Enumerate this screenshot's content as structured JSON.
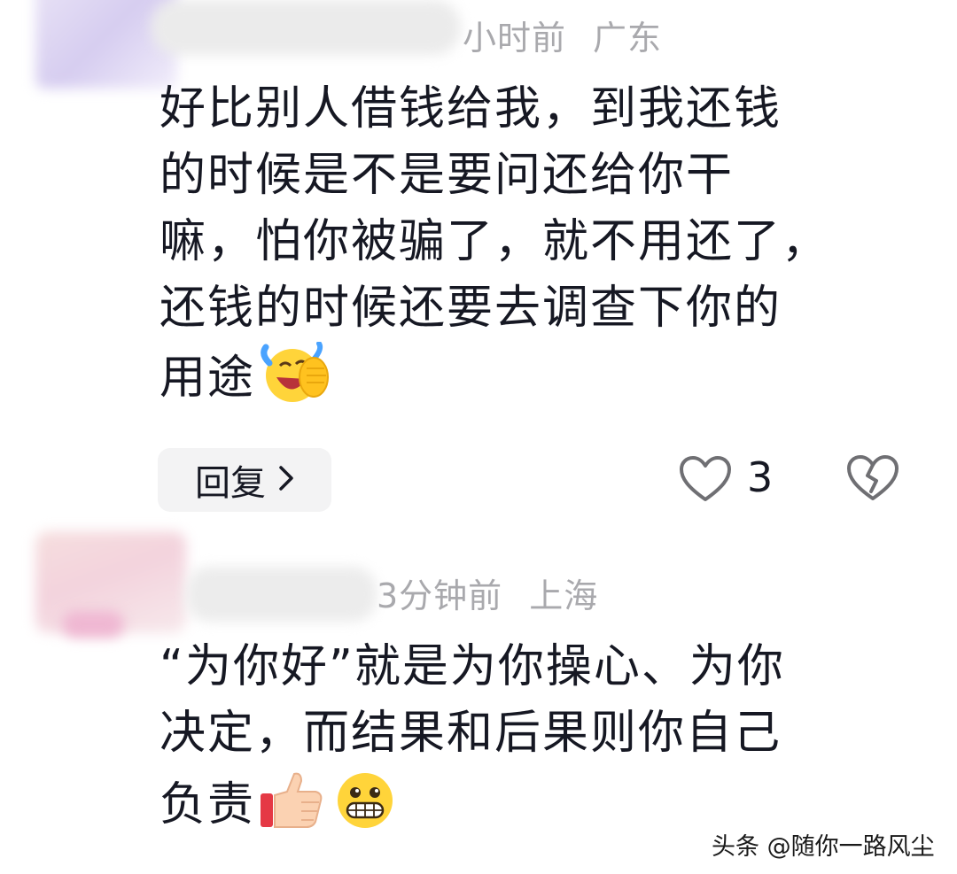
{
  "comments": [
    {
      "meta": {
        "time": "小时前",
        "location": "广东"
      },
      "lines": [
        "好比别人借钱给我，到我还钱",
        "的时候是不是要问还给你干",
        "嘛，怕你被骗了，就不用还了，",
        "还钱的时候还要去调查下你的",
        "用途"
      ],
      "emoji": [
        "laughing-tears-emoji-icon"
      ],
      "actions": {
        "reply_label": "回复",
        "like_count": "3"
      }
    },
    {
      "meta": {
        "time": "3分钟前",
        "location": "上海"
      },
      "lines": [
        "“为你好”就是为你操心、为你",
        "决定，而结果和后果则你自己",
        "负责"
      ],
      "emoji": [
        "thumbs-up-emoji-icon",
        "grinning-emoji-icon"
      ]
    }
  ],
  "icons": {
    "like": "heart-outline-icon",
    "dislike": "broken-heart-icon",
    "reply_chevron": "chevron-right-icon"
  },
  "watermark": "头条 @随你一路风尘",
  "colors": {
    "text": "#161823",
    "meta": "#a9a9ad",
    "reply_bg": "#f3f3f4",
    "icon": "#6f6f73"
  }
}
